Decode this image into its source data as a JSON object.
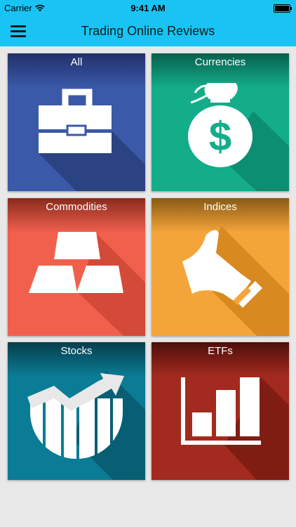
{
  "status": {
    "carrier": "Carrier",
    "time": "9:41 AM"
  },
  "header": {
    "title": "Trading Online Reviews"
  },
  "tiles": [
    {
      "label": "All",
      "icon": "briefcase-icon",
      "color": "#3a59a8"
    },
    {
      "label": "Currencies",
      "icon": "money-bag-icon",
      "color": "#13ad8a"
    },
    {
      "label": "Commodities",
      "icon": "gold-bars-icon",
      "color": "#f1604d"
    },
    {
      "label": "Indices",
      "icon": "thumbs-up-icon",
      "color": "#f4a53a"
    },
    {
      "label": "Stocks",
      "icon": "stock-chart-icon",
      "color": "#0b7c95"
    },
    {
      "label": "ETFs",
      "icon": "bar-chart-icon",
      "color": "#a32a1e"
    }
  ]
}
